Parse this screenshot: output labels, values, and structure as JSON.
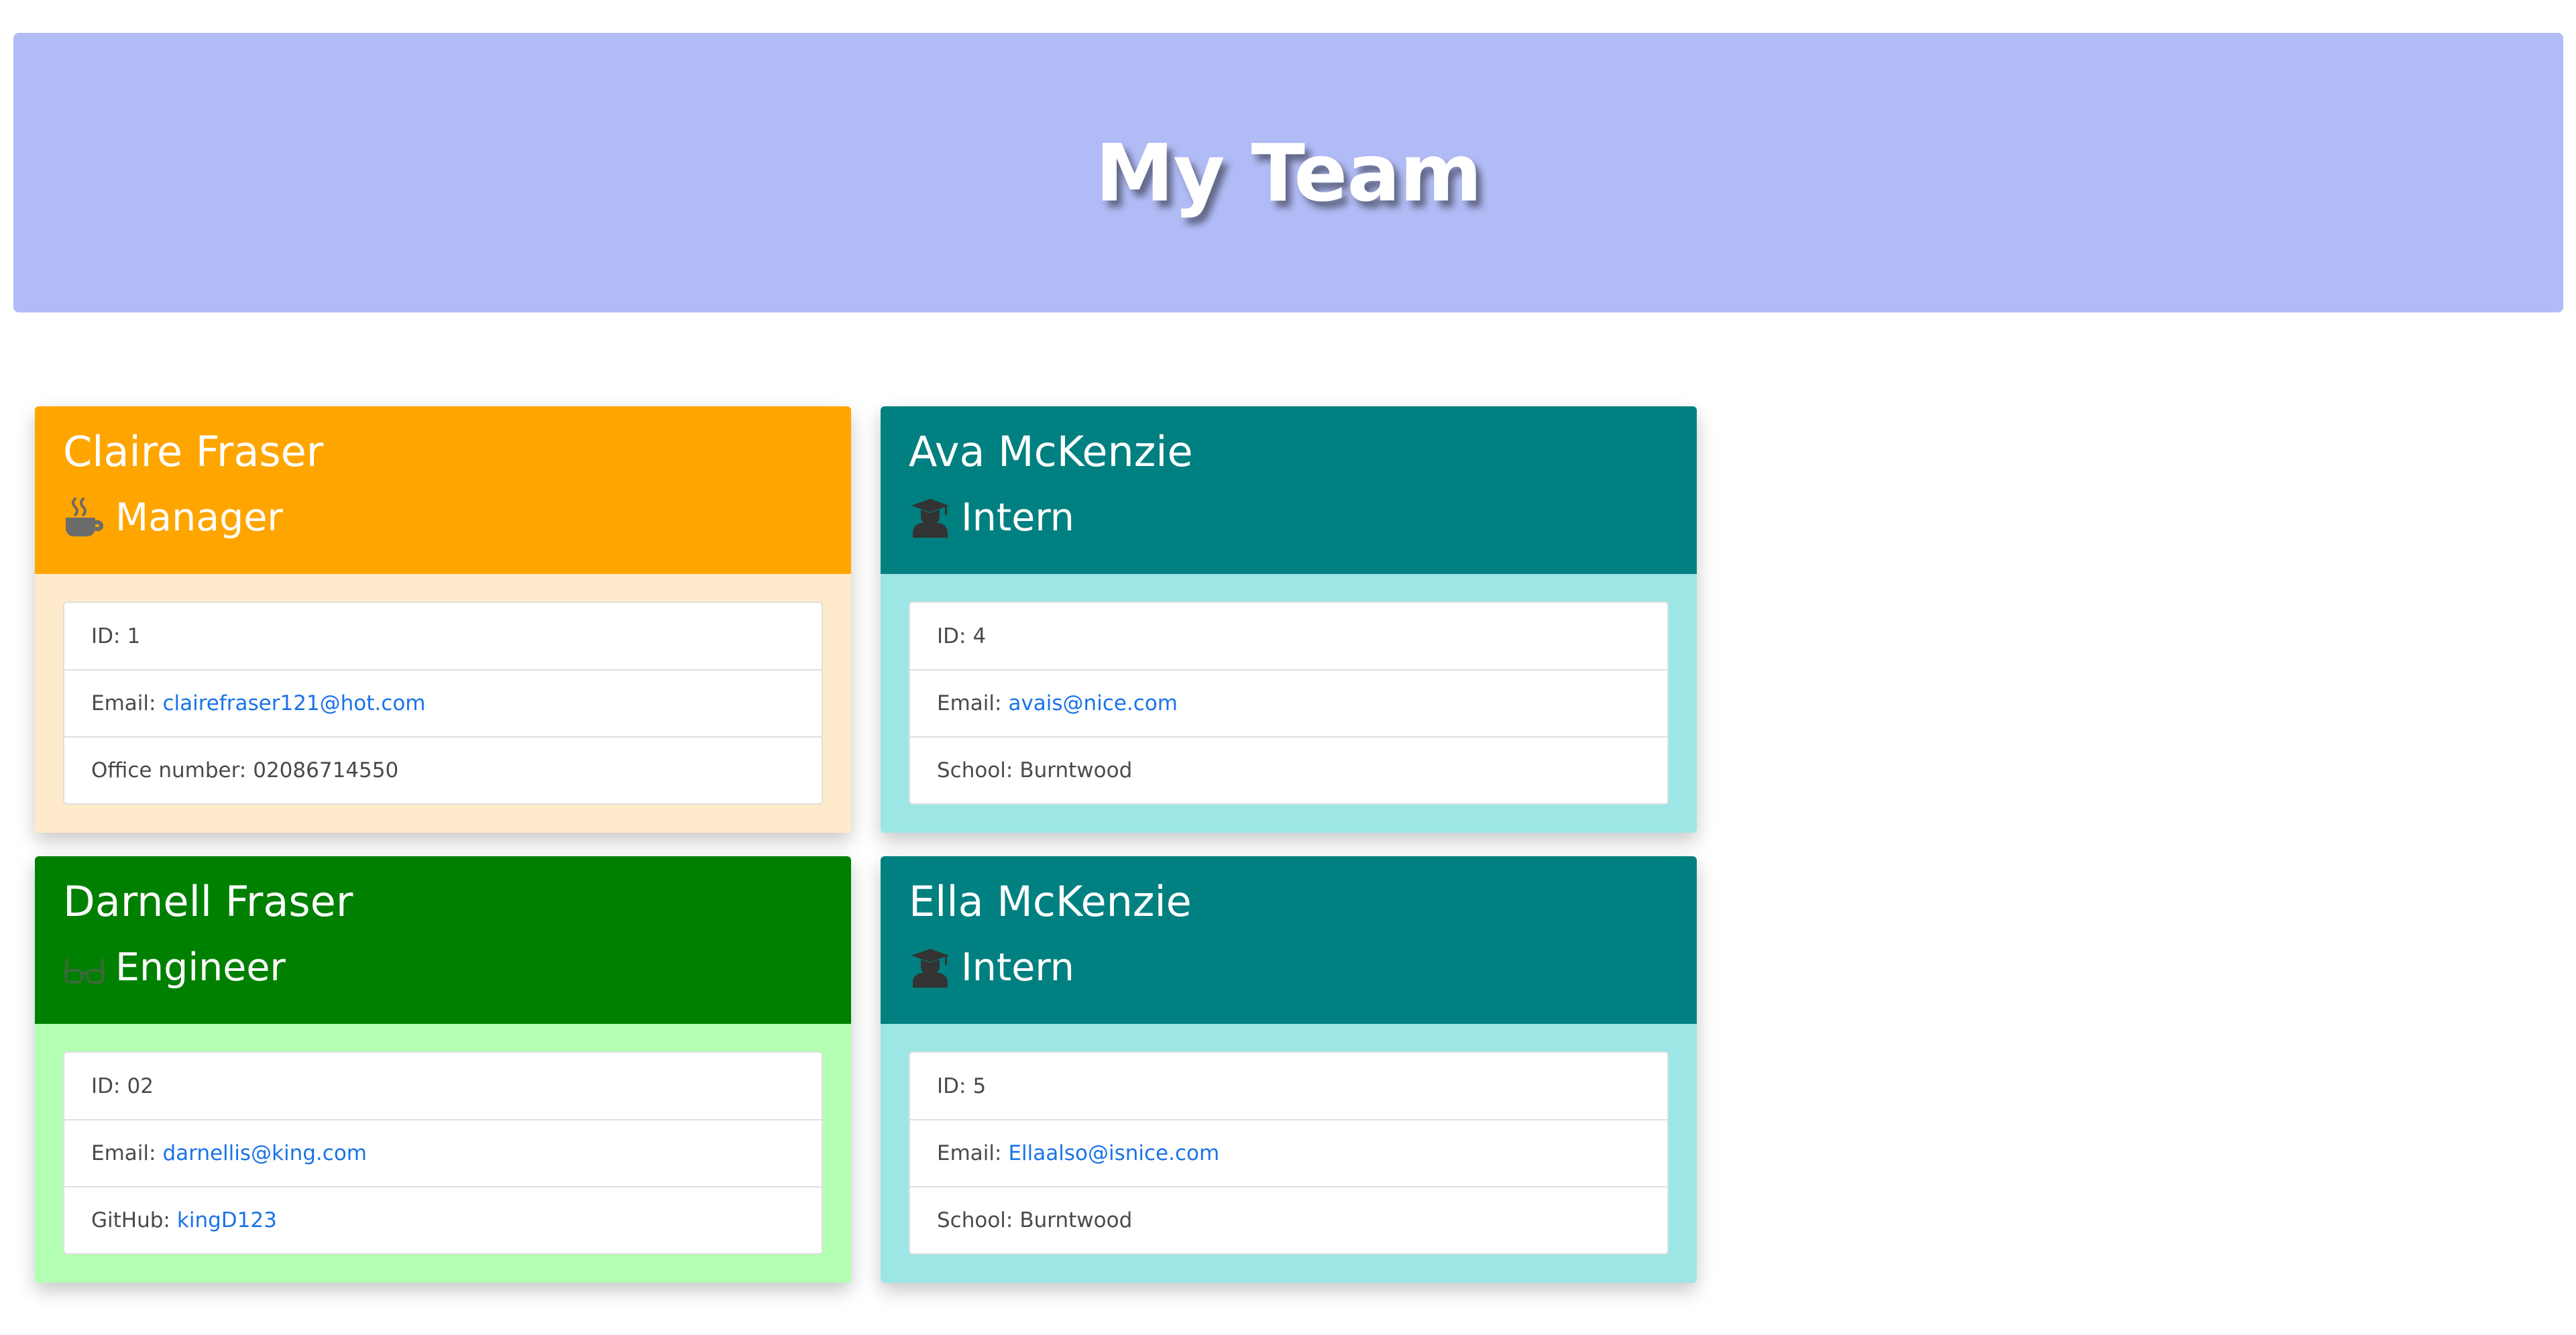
{
  "header": {
    "title": "My Team"
  },
  "colors": {
    "header_bg": "#b1bbf5",
    "manager_head": "#ffa500",
    "manager_body": "#ffebcc",
    "engineer_head": "#008000",
    "engineer_body": "#b3ffb3",
    "intern_head": "#008080",
    "intern_body": "#9de6e6",
    "link": "#1a73e8"
  },
  "cards": [
    {
      "name": "Claire Fraser",
      "role": "Manager",
      "role_icon": "mug-hot-icon",
      "id_label": "ID:",
      "id": "1",
      "email_label": "Email:",
      "email": "clairefraser121@hot.com",
      "extra_label": "Office number:",
      "extra": "02086714550"
    },
    {
      "name": "Ava McKenzie",
      "role": "Intern",
      "role_icon": "user-graduate-icon",
      "id_label": "ID:",
      "id": "4",
      "email_label": "Email:",
      "email": "avais@nice.com",
      "extra_label": "School:",
      "extra": "Burntwood"
    },
    {
      "name": "Darnell Fraser",
      "role": "Engineer",
      "role_icon": "glasses-icon",
      "id_label": "ID:",
      "id": "02",
      "email_label": "Email:",
      "email": "darnellis@king.com",
      "extra_label": "GitHub:",
      "extra": "kingD123"
    },
    {
      "name": "Ella McKenzie",
      "role": "Intern",
      "role_icon": "user-graduate-icon",
      "id_label": "ID:",
      "id": "5",
      "email_label": "Email:",
      "email": "Ellaalso@isnice.com",
      "extra_label": "School:",
      "extra": "Burntwood"
    }
  ]
}
